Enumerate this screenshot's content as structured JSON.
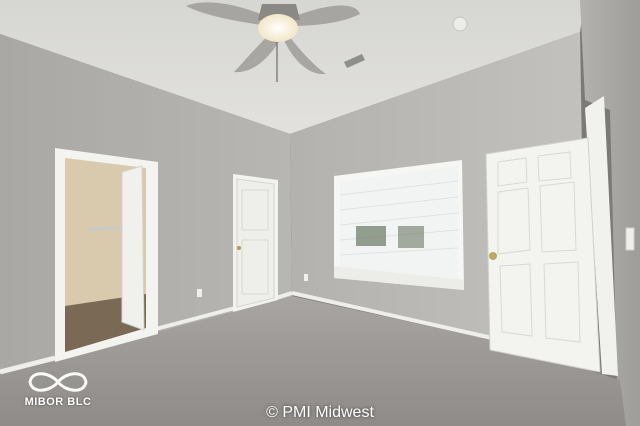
{
  "watermark": {
    "logo_text": "MIBOR BLC",
    "credit": "© PMI Midwest"
  },
  "colors": {
    "wall": "#b9b8b4",
    "wall_shadow": "#a6a5a1",
    "ceiling": "#dcdbd7",
    "carpet": "#9a9794",
    "door": "#f2f2ef",
    "closet_wall": "#d8c8ae",
    "window_glass": "#f4f5f5"
  }
}
